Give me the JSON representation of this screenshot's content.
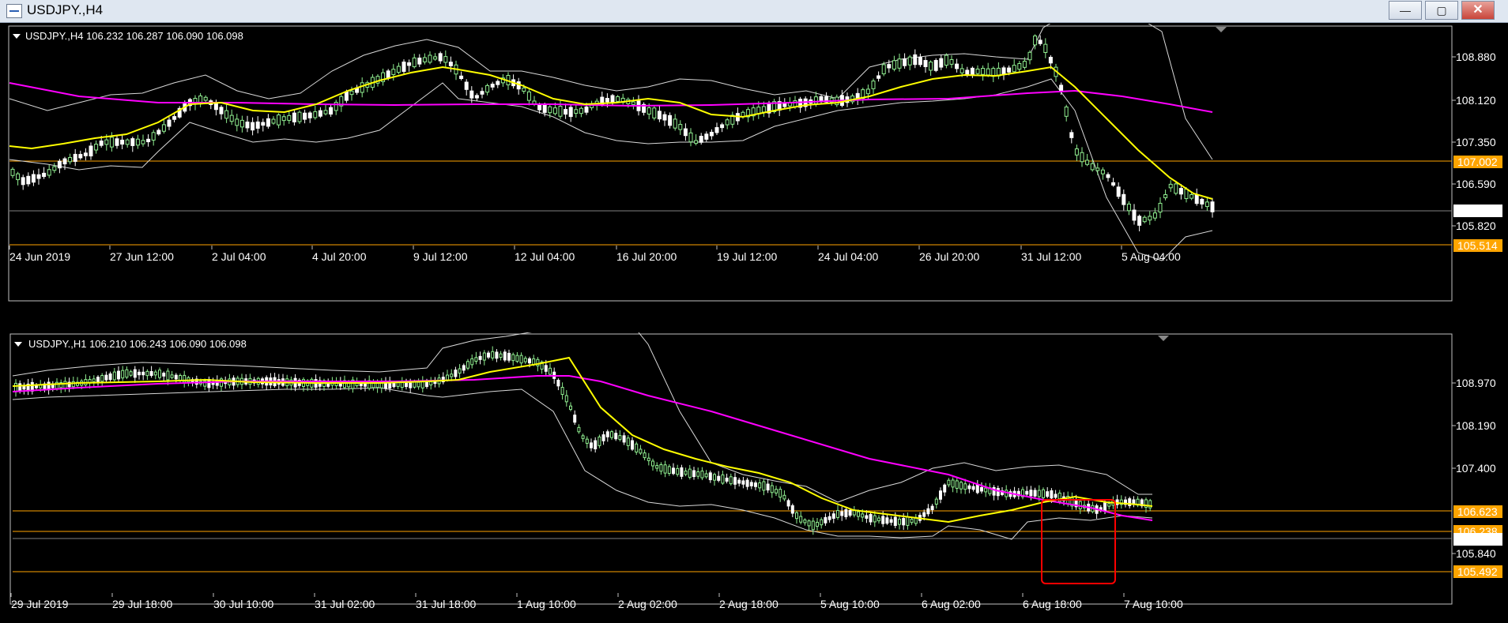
{
  "window": {
    "title": "USDJPY.,H4",
    "buttons": [
      "minimize",
      "maximize",
      "close"
    ]
  },
  "charts": [
    {
      "symbol_line": "USDJPY.,H4  106.232 106.287 106.090 106.098",
      "y_ticks": [
        "108.880",
        "108.120",
        "107.350",
        "106.590",
        "105.820"
      ],
      "x_labels": [
        "24 Jun 2019",
        "27 Jun 12:00",
        "2 Jul 04:00",
        "4 Jul 20:00",
        "9 Jul 12:00",
        "12 Jul 04:00",
        "16 Jul 20:00",
        "19 Jul 12:00",
        "24 Jul 04:00",
        "26 Jul 20:00",
        "31 Jul 12:00",
        "5 Aug 04:00"
      ],
      "price_tags": [
        {
          "text": "107.002",
          "color": "#ffa500"
        },
        {
          "text": "106.098",
          "color": "#ffffff"
        },
        {
          "text": "105.514",
          "color": "#ffa500"
        }
      ]
    },
    {
      "symbol_line": "USDJPY.,H1  106.210 106.243 106.090 106.098",
      "y_ticks": [
        "108.970",
        "108.190",
        "107.400",
        "105.840"
      ],
      "x_labels": [
        "29 Jul 2019",
        "29 Jul 18:00",
        "30 Jul 10:00",
        "31 Jul 02:00",
        "31 Jul 18:00",
        "1 Aug 10:00",
        "2 Aug 02:00",
        "2 Aug 18:00",
        "5 Aug 10:00",
        "6 Aug 02:00",
        "6 Aug 18:00",
        "7 Aug 10:00"
      ],
      "price_tags": [
        {
          "text": "106.623",
          "color": "#ffa500"
        },
        {
          "text": "106.238",
          "color": "#ffa500"
        },
        {
          "text": "106.098",
          "color": "#ffffff"
        },
        {
          "text": "105.492",
          "color": "#ffa500"
        }
      ]
    }
  ],
  "colors": {
    "bull": "#90ee90",
    "bear": "#ffffff",
    "ma_fast": "#ffff00",
    "ma_slow": "#ff00ff",
    "bands": "#d8d8d8",
    "level": "#ffa500",
    "highlight": "#ff0000"
  }
}
